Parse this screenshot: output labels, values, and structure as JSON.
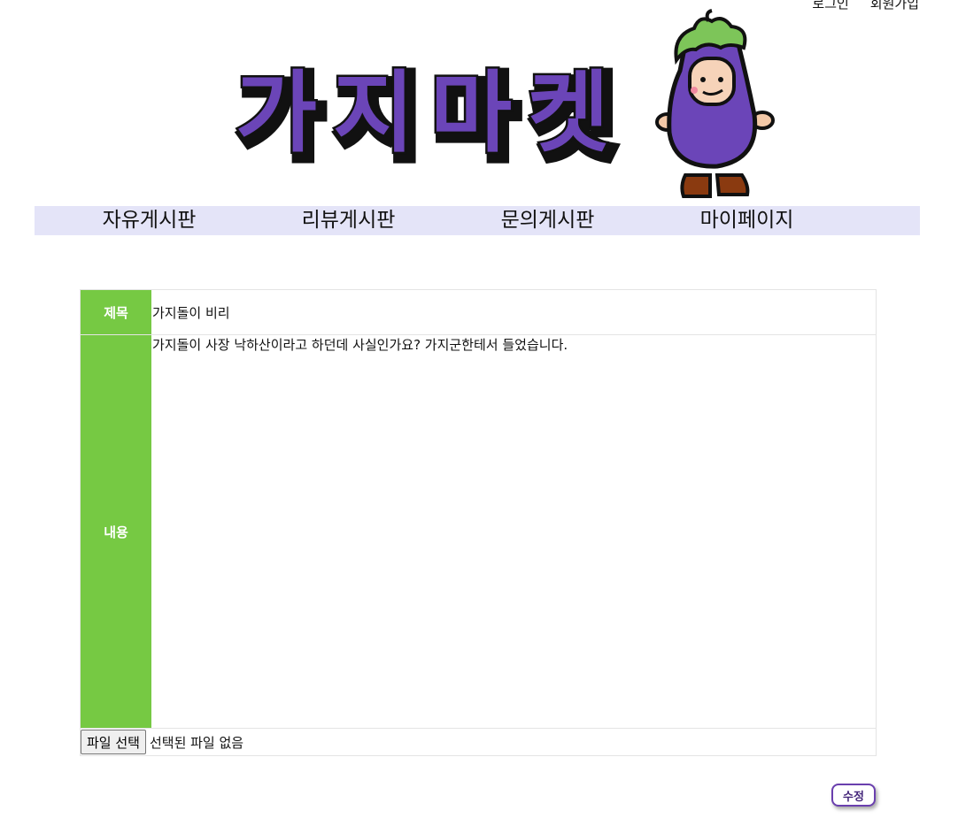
{
  "header": {
    "login_label": "로그인",
    "signup_label": "회원가입",
    "logo_text": [
      "가",
      "지",
      "마",
      "켓"
    ]
  },
  "nav": {
    "items": [
      {
        "label": "자유게시판"
      },
      {
        "label": "리뷰게시판"
      },
      {
        "label": "문의게시판"
      },
      {
        "label": "마이페이지"
      }
    ]
  },
  "form": {
    "title_label": "제목",
    "title_value": "가지돌이 비리",
    "content_label": "내용",
    "content_value": "가지돌이 사장 낙하산이라고 하던데 사실인가요? 가지군한테서 들었습니다.",
    "file_button_label": "파일 선택",
    "file_status": "선택된 파일 없음"
  },
  "actions": {
    "submit_label": "수정"
  },
  "colors": {
    "accent_green": "#76c943",
    "nav_bg": "#e4e4f8",
    "logo_purple": "#6b45b8",
    "button_border": "#6a3fae"
  },
  "icons": {
    "mascot": "eggplant-mascot"
  }
}
